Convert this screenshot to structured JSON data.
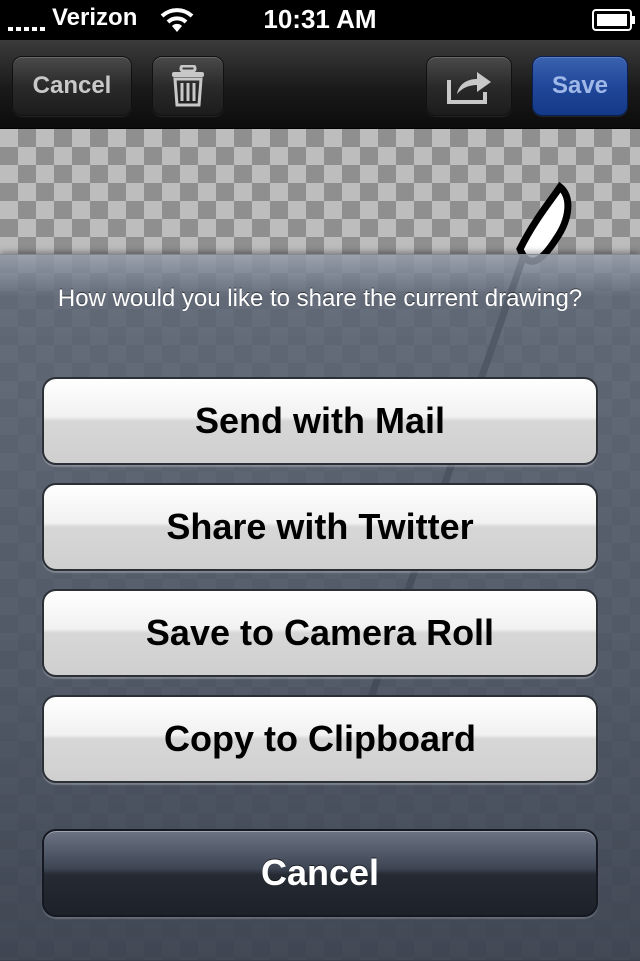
{
  "status_bar": {
    "carrier": "Verizon",
    "time": "10:31 AM"
  },
  "toolbar": {
    "cancel_label": "Cancel",
    "save_label": "Save",
    "icons": [
      "trash-icon",
      "share-icon"
    ],
    "save_color": "#20479a"
  },
  "action_sheet": {
    "title": "How would you like to share the current drawing?",
    "buttons": [
      {
        "label": "Send with Mail"
      },
      {
        "label": "Share with Twitter"
      },
      {
        "label": "Save to Camera Roll"
      },
      {
        "label": "Copy to Clipboard"
      }
    ],
    "cancel_label": "Cancel"
  }
}
